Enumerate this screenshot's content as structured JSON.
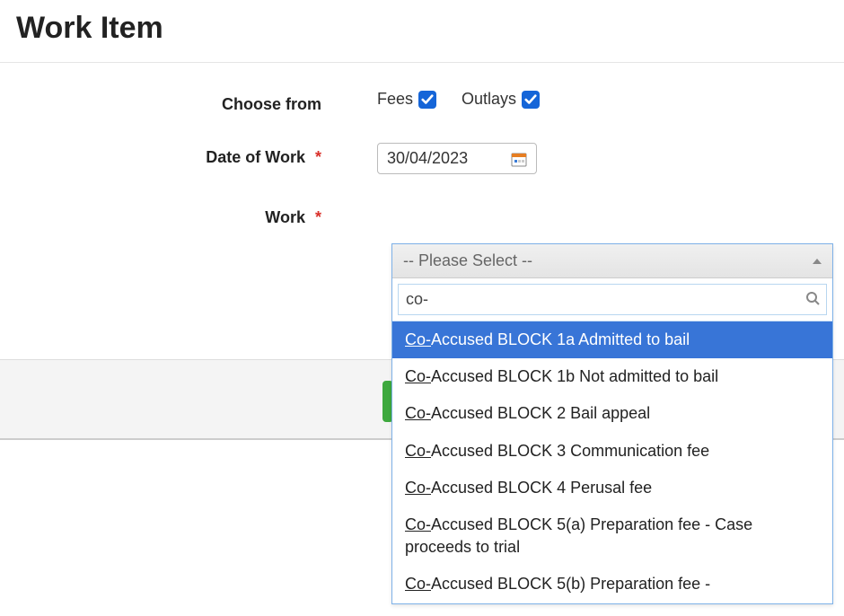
{
  "page_title": "Work Item",
  "form": {
    "choose_from": {
      "label": "Choose from",
      "fees_label": "Fees",
      "fees_checked": true,
      "outlays_label": "Outlays",
      "outlays_checked": true
    },
    "date_of_work": {
      "label": "Date of Work",
      "required": true,
      "value": "30/04/2023"
    },
    "work": {
      "label": "Work",
      "required": true,
      "placeholder": "-- Please Select --",
      "search_value": "co-",
      "match_prefix": "Co-",
      "options": [
        {
          "rest": "Accused BLOCK 1a Admitted to bail",
          "highlighted": true
        },
        {
          "rest": "Accused BLOCK 1b Not admitted to bail",
          "highlighted": false
        },
        {
          "rest": "Accused BLOCK 2 Bail appeal",
          "highlighted": false
        },
        {
          "rest": "Accused BLOCK 3 Communication fee",
          "highlighted": false
        },
        {
          "rest": "Accused BLOCK 4 Perusal fee",
          "highlighted": false
        },
        {
          "rest": "Accused BLOCK 5(a) Preparation fee - Case proceeds to trial",
          "highlighted": false
        },
        {
          "rest": "Accused BLOCK 5(b) Preparation fee -",
          "highlighted": false
        }
      ]
    }
  }
}
